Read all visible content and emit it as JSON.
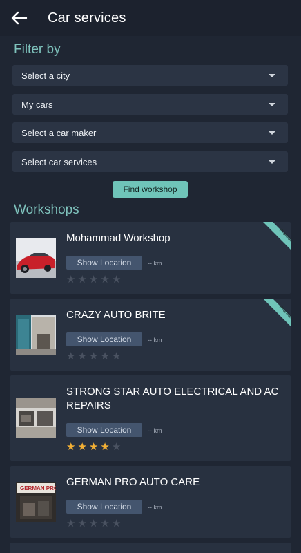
{
  "appbar": {
    "title": "Car services"
  },
  "filter": {
    "title": "Filter by",
    "selects": [
      {
        "label": "Select a city"
      },
      {
        "label": "My cars"
      },
      {
        "label": "Select a car maker"
      },
      {
        "label": "Select car services"
      }
    ],
    "find_button": "Find workshop"
  },
  "workshops": {
    "title": "Workshops",
    "items": [
      {
        "name": "Mohammad Workshop",
        "location_button": "Show Location",
        "distance": "-- km",
        "rating": 0,
        "promoted": "Promoted"
      },
      {
        "name": "CRAZY AUTO BRITE",
        "location_button": "Show Location",
        "distance": "-- km",
        "rating": 0,
        "promoted": "Promoted"
      },
      {
        "name": "STRONG STAR AUTO ELECTRICAL AND AC REPAIRS",
        "location_button": "Show Location",
        "distance": "-- km",
        "rating": 4
      },
      {
        "name": "GERMAN PRO AUTO CARE",
        "location_button": "Show Location",
        "distance": "-- km",
        "rating": 0,
        "sign_text": "GERMAN PRO"
      }
    ]
  },
  "colors": {
    "accent": "#6fc4b9",
    "star": "#f3b035",
    "background": "#1f2633",
    "card": "#283140"
  }
}
